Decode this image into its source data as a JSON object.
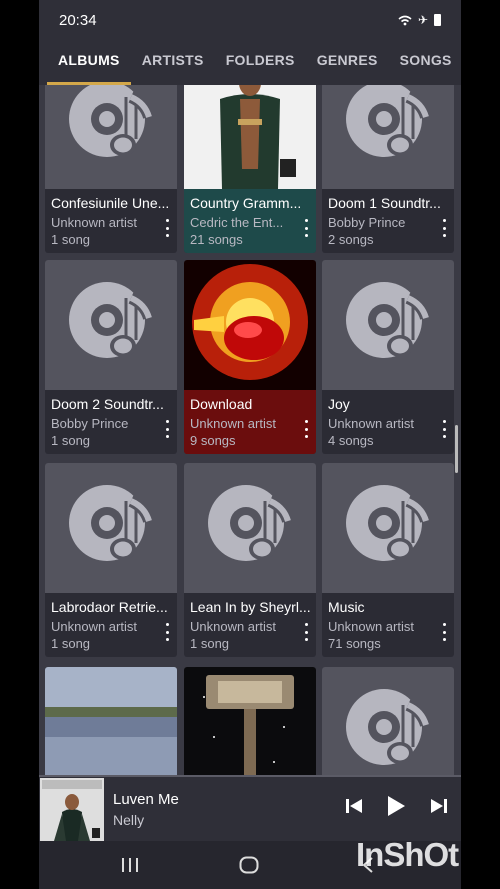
{
  "status": {
    "time": "20:34"
  },
  "tabs": [
    {
      "label": "ALBUMS",
      "active": true
    },
    {
      "label": "ARTISTS",
      "active": false
    },
    {
      "label": "FOLDERS",
      "active": false
    },
    {
      "label": "GENRES",
      "active": false
    },
    {
      "label": "SONGS",
      "active": false
    }
  ],
  "albums": [
    {
      "title": "Confesiunile Une...",
      "artist": "Unknown artist",
      "count": "1 song",
      "art": "disc-icon"
    },
    {
      "title": "Country Gramm...",
      "artist": "Cedric the Ent...",
      "count": "21 songs",
      "art": "cover-photo",
      "highlight": "#1e4a4a"
    },
    {
      "title": "Doom 1 Soundtr...",
      "artist": "Bobby Prince",
      "count": "2 songs",
      "art": "disc-icon"
    },
    {
      "title": "Doom 2 Soundtr...",
      "artist": "Bobby Prince",
      "count": "1 song",
      "art": "disc-icon"
    },
    {
      "title": "Download",
      "artist": "Unknown artist",
      "count": "9 songs",
      "art": "cover-photo",
      "highlight": "#6b0d0d"
    },
    {
      "title": "Joy",
      "artist": "Unknown artist",
      "count": "4 songs",
      "art": "disc-icon"
    },
    {
      "title": "Labrodaor Retrie...",
      "artist": "Unknown artist",
      "count": "1 song",
      "art": "disc-icon"
    },
    {
      "title": "Lean In by Sheyrl...",
      "artist": "Unknown artist",
      "count": "1 song",
      "art": "disc-icon"
    },
    {
      "title": "Music",
      "artist": "Unknown artist",
      "count": "71 songs",
      "art": "disc-icon"
    },
    {
      "title": "",
      "artist": "",
      "count": "",
      "art": "cover-photo"
    },
    {
      "title": "",
      "artist": "",
      "count": "",
      "art": "cover-photo"
    },
    {
      "title": "",
      "artist": "",
      "count": "",
      "art": "disc-icon"
    }
  ],
  "now_playing": {
    "title": "Luven Me",
    "artist": "Nelly"
  },
  "watermark": "InShOt",
  "colors": {
    "accent": "#d4a84a",
    "card": "#2b2b34",
    "art_bg": "#54545e"
  }
}
